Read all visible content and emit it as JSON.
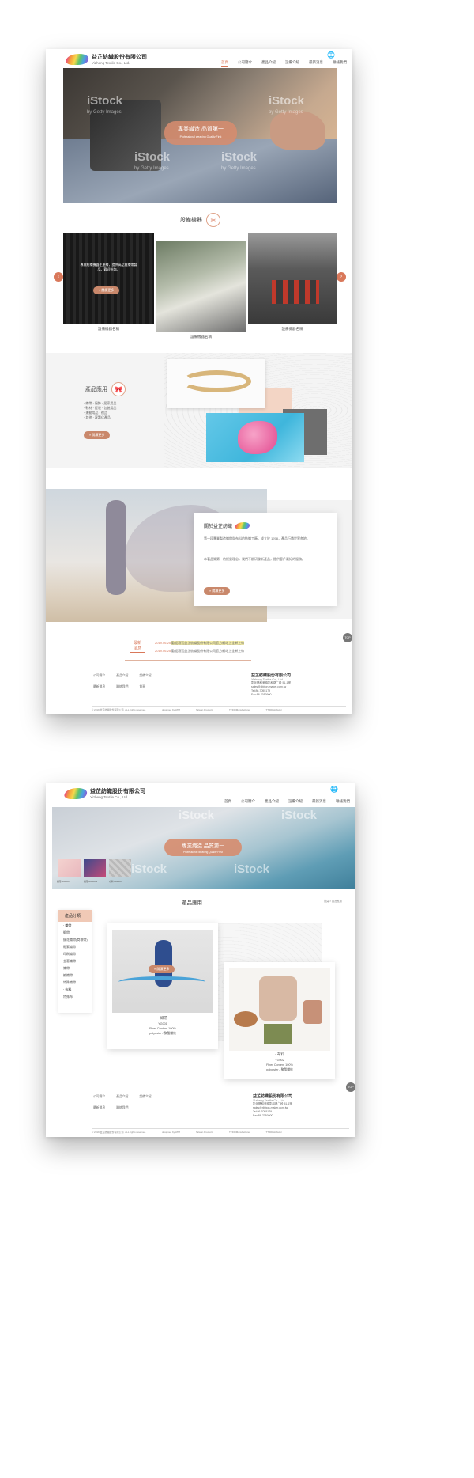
{
  "company": {
    "name_cn": "益芷紡織股份有限公司",
    "name_en": "Yizheng Textile Co., Ltd."
  },
  "nav": {
    "items": [
      "首頁",
      "公司簡介",
      "產品介紹",
      "設備介紹",
      "最新消息",
      "聯絡我們"
    ],
    "active_index": 0
  },
  "hero1": {
    "title": "專業織造 品質第一",
    "subtitle": "Professional weaving Quality First",
    "watermark": "iStock",
    "watermark_sub": "by Getty Images"
  },
  "equipment": {
    "title": "設備機器",
    "items": [
      {
        "caption": "設備機器名稱",
        "overlay": "專業紡織機器生產線，提供高品質織帶製品，歡迎洽詢。"
      },
      {
        "caption": "設備機器名稱"
      },
      {
        "caption": "設備機器名稱"
      }
    ],
    "more_label": "» 閱讀更多"
  },
  "products": {
    "title": "產品應用",
    "list": [
      "‧ 織帶 ‧ 服飾 ‧ 居家用品",
      "‧ 鞋材 ‧ 提袋 ‧ 包裝用品",
      "‧ 運動用品 ‧ 禮品",
      "‧ 其他 ‧ 客製化產品"
    ],
    "more_label": "» 閱讀更多"
  },
  "about": {
    "title": "關於益芷紡織",
    "paragraph1": "第一段專業製造織帶與布料的紡織工廠，成立於 1978，產品行銷世界各地。",
    "paragraph2": "本著品質第一的經營理念，我們不斷研發新產品，提供客戶最好的服務。",
    "more_label": "» 閱讀更多"
  },
  "news": {
    "label_top": "最新",
    "label_bottom": "消息",
    "items": [
      {
        "date": "2019.06.25",
        "text": "歡迎瀏覽益芷紡織股份有限公司官方網站上全新上線"
      },
      {
        "date": "2019.06.25",
        "text": "歡迎瀏覽益芷紡織股份有限公司官方網站上全新上線"
      }
    ]
  },
  "footer": {
    "links": [
      "公司簡介",
      "產品介紹",
      "設備介紹",
      "最新消息",
      "聯絡我們",
      "首頁"
    ],
    "company_cn": "益芷紡織股份有限公司",
    "company_en": "Yizheng Textile Co., Ltd.",
    "address": "彰化縣和美鎮彰和路二段 51-1號",
    "email": "sales@ribbon-maker.com.tw",
    "tel": "Tel:86-7055179",
    "fax": "Fax:86-7050900",
    "copyright": "© 2019 益芷紡織股份有限公司. ALL rights reserved.",
    "designed_by": "designed by ATM",
    "bar_items": [
      "Taiwan Products",
      "TTIDDManufacturer",
      "TTIDDistributor"
    ],
    "top_label": "TOP"
  },
  "page2": {
    "hero_title": "專業織造 品質第一",
    "hero_subtitle": "Professional weaving Quality First",
    "page_title": "產品應用",
    "breadcrumb": "首頁 > 產品應用",
    "thumbs": [
      "織帶 RIBBON",
      "緞帶 RIBBON",
      "布料 FABRIC"
    ],
    "sidebar_title": "產品分類",
    "sidebar_items": [
      "‧ 織帶",
      "緞帶",
      "緹花織帶(商標帶)",
      "鬆緊織帶",
      "印刷織帶",
      "金蔥織帶",
      "織帶",
      "編織帶",
      "特殊織帶",
      "‧ 布料",
      "特殊布"
    ],
    "product1": {
      "name": "‧ 織帶",
      "code": "YG001",
      "content": "Fiber Content 100%",
      "material": "polyester / 聚酯纖維"
    },
    "product2": {
      "name": "‧ 布料",
      "code": "YG002",
      "content": "Fiber Content 100%",
      "material": "polyester / 聚酯纖維"
    },
    "more_label": "» 閱讀更多"
  },
  "colors": {
    "accent": "#d9785a",
    "pill": "#c9886b",
    "pink_bg": "#f3d5c5"
  }
}
